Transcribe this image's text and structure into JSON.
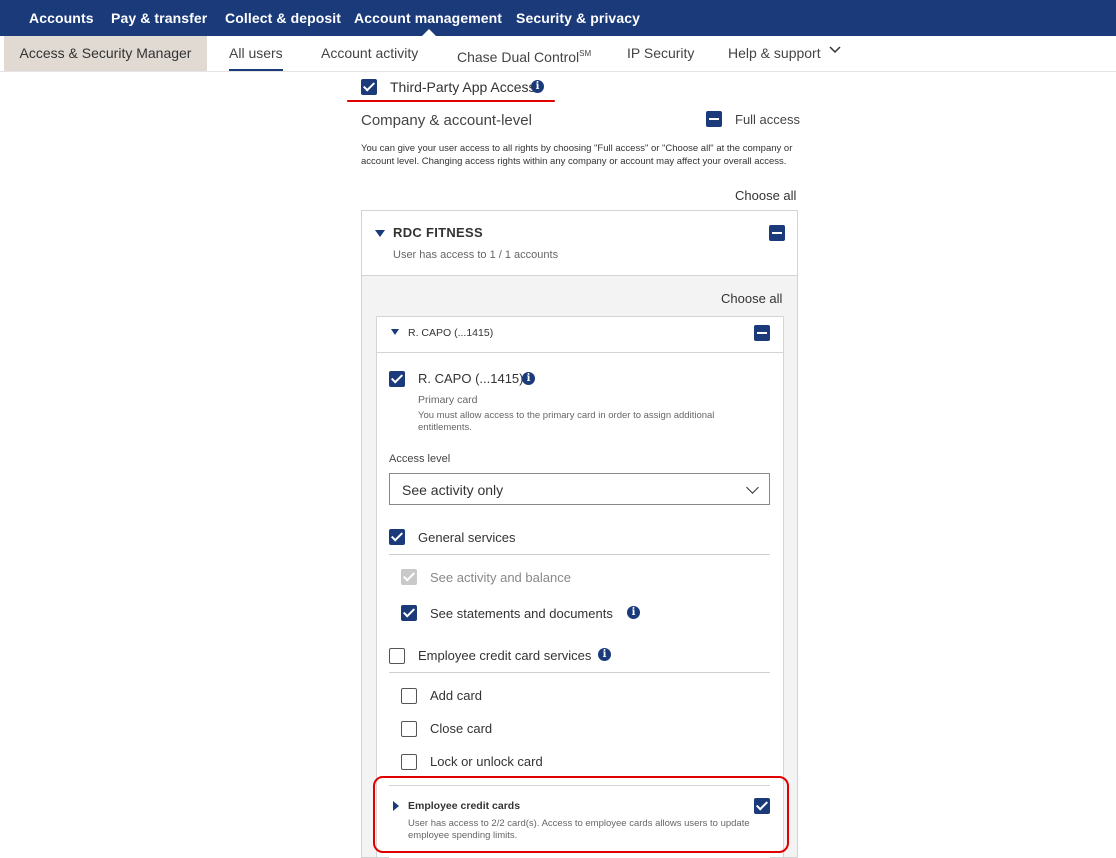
{
  "topnav": {
    "items": [
      "Accounts",
      "Pay & transfer",
      "Collect & deposit",
      "Account management",
      "Security & privacy"
    ]
  },
  "subnav": {
    "section": "Access & Security Manager",
    "tabs": [
      "All users",
      "Account activity",
      "Chase Dual Control",
      "IP Security",
      "Help & support"
    ],
    "dual_control_sup": "SM"
  },
  "third_party": {
    "label": "Third-Party App Access",
    "checked": true
  },
  "company": {
    "heading": "Company & account-level",
    "full_access_label": "Full access",
    "description": "You can give your user access to all rights by choosing \"Full access\" or \"Choose all\" at the company or account level. Changing access rights within any company or account may affect your overall access.",
    "choose_all": "Choose all"
  },
  "rdc": {
    "title": "RDC FITNESS",
    "subtitle": "User has access to 1 / 1 accounts",
    "choose_all": "Choose all"
  },
  "account": {
    "header": "R. CAPO (...1415)",
    "card_label": "R. CAPO (...1415)",
    "card_type": "Primary card",
    "card_note": "You must allow access to the primary card in order to assign additional entitlements.",
    "access_level_label": "Access level",
    "access_level_value": "See activity only",
    "general_services": "General services",
    "see_activity": "See activity and balance",
    "see_statements": "See statements and documents",
    "employee_services": "Employee credit card services",
    "add_card": "Add card",
    "close_card": "Close card",
    "lock_card": "Lock or unlock card",
    "employee_cards_title": "Employee credit cards",
    "employee_cards_desc": "User has access to 2/2 card(s). Access to employee cards allows users to update employee spending limits."
  },
  "colors": {
    "brand": "#1a3a7a",
    "highlight": "#e00000",
    "tab_bg": "#e0dad3"
  }
}
